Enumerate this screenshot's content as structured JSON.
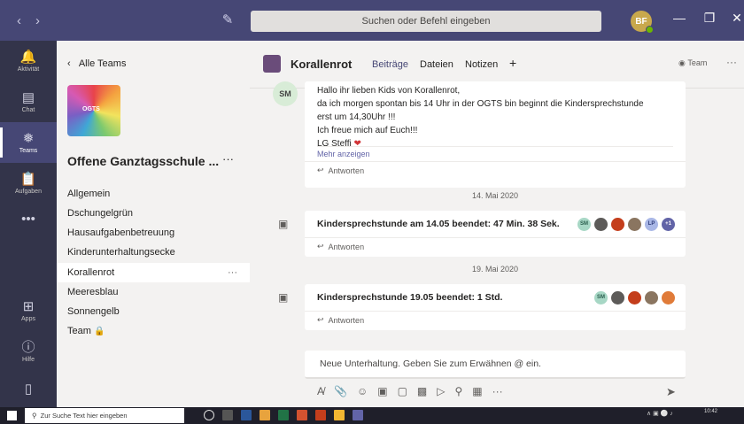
{
  "titlebar": {
    "search_placeholder": "Suchen oder Befehl eingeben",
    "avatar_initials": "BF"
  },
  "rail": [
    {
      "label": "Aktivität",
      "icon": "bell-icon"
    },
    {
      "label": "Chat",
      "icon": "chat-icon"
    },
    {
      "label": "Teams",
      "icon": "teams-icon"
    },
    {
      "label": "Aufgaben",
      "icon": "tasks-icon"
    },
    {
      "label": "Apps",
      "icon": "apps-icon"
    },
    {
      "label": "Hilfe",
      "icon": "help-icon"
    }
  ],
  "panel": {
    "back_label": "Alle Teams",
    "team_image_text": "OGTS",
    "team_name": "Offene Ganztagsschule ...",
    "channels": [
      "Allgemein",
      "Dschungelgrün",
      "Hausaufgabenbetreuung",
      "Kinderunterhaltungsecke",
      "Korallenrot",
      "Meeresblau",
      "Sonnengelb",
      "Team"
    ]
  },
  "channel": {
    "title": "Korallenrot",
    "tabs": [
      "Beiträge",
      "Dateien",
      "Notizen"
    ],
    "team_button": "Team"
  },
  "messages": {
    "post": {
      "avatar": "SM",
      "lines": [
        "Hallo ihr lieben Kids von Korallenrot,",
        "da ich morgen spontan bis 14 Uhr in der OGTS bin beginnt die Kindersprechstunde",
        "erst um 14,30Uhr !!!",
        "Ich freue mich auf Euch!!!",
        "LG Steffi"
      ],
      "more_label": "Mehr anzeigen",
      "reply_label": "Antworten"
    },
    "date1": "14. Mai 2020",
    "meeting1": {
      "text": "Kindersprechstunde am 14.05 beendet: 47 Min. 38 Sek.",
      "reply_label": "Antworten",
      "overflow": "+1"
    },
    "date2": "19. Mai 2020",
    "meeting2": {
      "text": "Kindersprechstunde 19.05 beendet: 1 Std.",
      "reply_label": "Antworten"
    },
    "participants1": [
      "SM",
      "",
      "",
      "",
      "LP"
    ],
    "participants2": [
      "SM",
      "",
      "",
      "",
      ""
    ]
  },
  "compose": {
    "placeholder": "Neue Unterhaltung. Geben Sie zum Erwähnen @ ein."
  },
  "taskbar": {
    "search_placeholder": "Zur Suche Text hier eingeben",
    "time": "10:42"
  }
}
